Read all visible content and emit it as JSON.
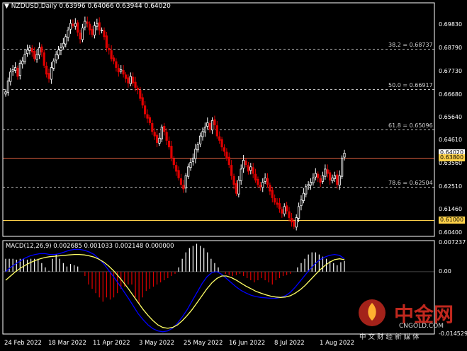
{
  "header": {
    "symbol": "NZDUSD,Daily",
    "ohlc": "0.63996 0.64066 0.63944 0.64020"
  },
  "macd": {
    "label": "MACD(12,26,9) 0.002685 0.001033 0.002148 0.000000"
  },
  "price_axis": [
    "0.69830",
    "0.68790",
    "0.67730",
    "0.66680",
    "0.65640",
    "0.64610",
    "0.63560",
    "0.62510",
    "0.61460",
    "0.60400"
  ],
  "macd_axis": [
    "0.007237",
    "0.00",
    "-0.014529"
  ],
  "tags": {
    "current": {
      "text": "0.64020",
      "color": "#ffffff"
    },
    "hline1": {
      "text": "0.63800",
      "color": "#ffd24a"
    },
    "hline2": {
      "text": "0.61000",
      "color": "#ffd24a"
    }
  },
  "fib_levels": [
    {
      "label": "38.2 = 0.68737",
      "value": 0.68737
    },
    {
      "label": "50.0 = 0.66917",
      "value": 0.66917
    },
    {
      "label": "61.8 = 0.65096",
      "value": 0.65096
    },
    {
      "label": "78.6 = 0.62504",
      "value": 0.62504
    }
  ],
  "dates": [
    "24 Feb 2022",
    "18 Mar 2022",
    "11 Apr 2022",
    "3 May 2022",
    "25 May 2022",
    "16 Jun 2022",
    "8 Jul 2022",
    "1 Aug 2022"
  ],
  "watermark": {
    "title": "中金网",
    "url": "CNGOLD.COM",
    "slogan": "中 文 财 经 新 媒 体"
  },
  "colors": {
    "background": "#000000",
    "bull": "#ffffff",
    "bear": "#e00000",
    "macd_line": "#0000ff",
    "signal_line": "#ffff66",
    "hline_red": "#e06040",
    "hline_yellow": "#ffd24a",
    "watermark_red": "#c0281e"
  },
  "chart_data": {
    "type": "candlestick",
    "price_range": [
      0.6025,
      0.7045
    ],
    "closes": [
      0.668,
      0.673,
      0.677,
      0.678,
      0.679,
      0.675,
      0.681,
      0.682,
      0.685,
      0.687,
      0.688,
      0.686,
      0.683,
      0.685,
      0.688,
      0.686,
      0.68,
      0.676,
      0.674,
      0.679,
      0.682,
      0.685,
      0.687,
      0.688,
      0.69,
      0.693,
      0.696,
      0.699,
      0.698,
      0.699,
      0.695,
      0.692,
      0.697,
      0.7,
      0.699,
      0.696,
      0.694,
      0.698,
      0.699,
      0.696,
      0.696,
      0.693,
      0.688,
      0.687,
      0.683,
      0.682,
      0.679,
      0.677,
      0.678,
      0.676,
      0.674,
      0.672,
      0.675,
      0.672,
      0.67,
      0.669,
      0.665,
      0.662,
      0.658,
      0.656,
      0.654,
      0.65,
      0.648,
      0.645,
      0.647,
      0.652,
      0.65,
      0.646,
      0.643,
      0.638,
      0.635,
      0.632,
      0.629,
      0.626,
      0.624,
      0.63,
      0.634,
      0.636,
      0.638,
      0.642,
      0.644,
      0.648,
      0.65,
      0.652,
      0.654,
      0.651,
      0.655,
      0.653,
      0.648,
      0.646,
      0.643,
      0.641,
      0.638,
      0.635,
      0.63,
      0.626,
      0.622,
      0.628,
      0.633,
      0.637,
      0.635,
      0.632,
      0.634,
      0.631,
      0.628,
      0.626,
      0.625,
      0.627,
      0.629,
      0.626,
      0.623,
      0.62,
      0.618,
      0.617,
      0.615,
      0.613,
      0.616,
      0.614,
      0.611,
      0.609,
      0.607,
      0.611,
      0.616,
      0.619,
      0.622,
      0.625,
      0.626,
      0.627,
      0.629,
      0.631,
      0.629,
      0.627,
      0.63,
      0.633,
      0.631,
      0.628,
      0.629,
      0.63,
      0.626,
      0.63,
      0.638,
      0.6402
    ],
    "macd_range": [
      -0.014529,
      0.007237
    ],
    "macd_histogram": [
      0.003,
      0.003,
      0.003,
      0.0028,
      0.003,
      0.0031,
      0.0028,
      0.003,
      0.003,
      0.003,
      0.002,
      0.001,
      0.0002,
      0.003,
      0.004,
      0.003,
      0.002,
      0.0012,
      0.0018,
      0.0015,
      0.0012,
      0.0,
      -0.001,
      -0.003,
      -0.004,
      -0.005,
      -0.006,
      -0.007,
      -0.006,
      -0.0065,
      -0.006,
      -0.005,
      -0.004,
      -0.0035,
      -0.003,
      -0.003,
      -0.006,
      -0.0075,
      -0.006,
      -0.0045,
      -0.004,
      -0.0035,
      -0.003,
      -0.0025,
      -0.002,
      -0.0015,
      -0.001,
      -0.0005,
      0.001,
      0.003,
      0.0045,
      0.0055,
      0.006,
      0.0065,
      0.006,
      0.0055,
      0.0045,
      0.003,
      0.002,
      0.001,
      0.0,
      -0.0005,
      -0.0008,
      -0.001,
      -0.0008,
      -0.0005,
      -0.001,
      -0.0015,
      -0.002,
      -0.0025,
      -0.002,
      -0.0015,
      -0.002,
      -0.0025,
      -0.003,
      -0.002,
      -0.0015,
      -0.001,
      -0.0008,
      -0.0005,
      0.0,
      0.001,
      0.002,
      0.003,
      0.004,
      0.0045,
      0.0045,
      0.004,
      0.0035,
      0.003,
      0.0025,
      0.002,
      0.0015,
      0.0022,
      0.0025
    ],
    "macd_line": [
      0.0,
      0.001,
      0.0018,
      0.0025,
      0.0032,
      0.0037,
      0.004,
      0.0042,
      0.0042,
      0.004,
      0.004,
      0.0042,
      0.0046,
      0.005,
      0.0052,
      0.0052,
      0.005,
      0.0046,
      0.004,
      0.003,
      0.0018,
      0.0003,
      -0.0012,
      -0.0028,
      -0.0045,
      -0.0062,
      -0.008,
      -0.0098,
      -0.0112,
      -0.0124,
      -0.0133,
      -0.0138,
      -0.014,
      -0.0138,
      -0.0132,
      -0.012,
      -0.0105,
      -0.0088,
      -0.0068,
      -0.0048,
      -0.0028,
      -0.0012,
      -0.0002,
      0.0,
      -0.0006,
      -0.0016,
      -0.0026,
      -0.0036,
      -0.0044,
      -0.005,
      -0.0055,
      -0.0058,
      -0.006,
      -0.0061,
      -0.0062,
      -0.0062,
      -0.006,
      -0.0056,
      -0.0048,
      -0.0036,
      -0.0022,
      -0.0008,
      0.0006,
      0.0018,
      0.0028,
      0.0034,
      0.0038,
      0.004,
      0.0038,
      0.003
    ],
    "signal_line": [
      -0.002,
      -0.001,
      0.0,
      0.0008,
      0.0015,
      0.0021,
      0.0026,
      0.003,
      0.0033,
      0.0035,
      0.0036,
      0.0037,
      0.0038,
      0.0039,
      0.004,
      0.004,
      0.0039,
      0.0037,
      0.0034,
      0.0029,
      0.0022,
      0.0013,
      0.0002,
      -0.0011,
      -0.0025,
      -0.004,
      -0.0056,
      -0.0072,
      -0.0088,
      -0.0102,
      -0.0114,
      -0.0124,
      -0.013,
      -0.0132,
      -0.013,
      -0.0124,
      -0.0114,
      -0.0102,
      -0.0088,
      -0.0072,
      -0.0056,
      -0.004,
      -0.0026,
      -0.0016,
      -0.001,
      -0.001,
      -0.0014,
      -0.002,
      -0.0027,
      -0.0034,
      -0.004,
      -0.0046,
      -0.005,
      -0.0054,
      -0.0057,
      -0.0059,
      -0.006,
      -0.0059,
      -0.0056,
      -0.005,
      -0.0042,
      -0.0032,
      -0.002,
      -0.0008,
      0.0004,
      0.0014,
      0.0022,
      0.0028,
      0.003,
      0.0028
    ]
  }
}
